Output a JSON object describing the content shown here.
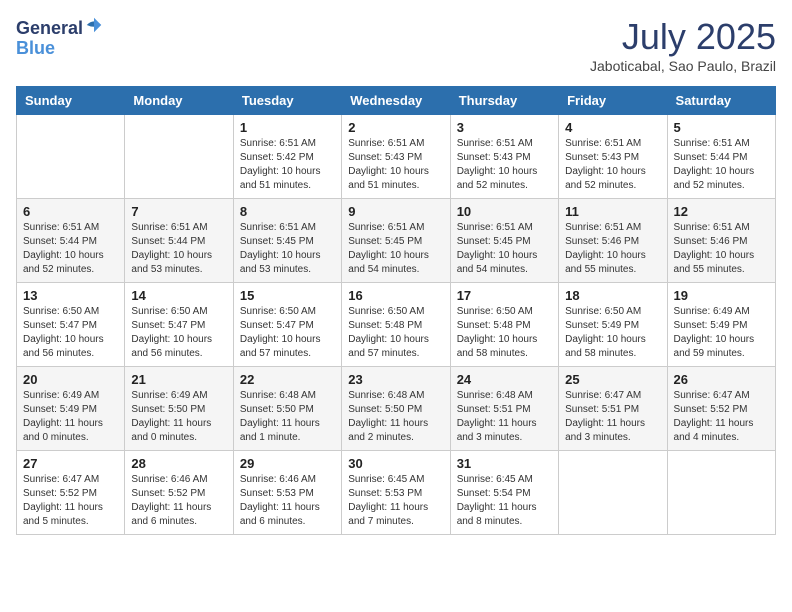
{
  "header": {
    "logo_line1": "General",
    "logo_line2": "Blue",
    "month": "July 2025",
    "location": "Jaboticabal, Sao Paulo, Brazil"
  },
  "days_of_week": [
    "Sunday",
    "Monday",
    "Tuesday",
    "Wednesday",
    "Thursday",
    "Friday",
    "Saturday"
  ],
  "weeks": [
    [
      {
        "day": "",
        "content": ""
      },
      {
        "day": "",
        "content": ""
      },
      {
        "day": "1",
        "content": "Sunrise: 6:51 AM\nSunset: 5:42 PM\nDaylight: 10 hours and 51 minutes."
      },
      {
        "day": "2",
        "content": "Sunrise: 6:51 AM\nSunset: 5:43 PM\nDaylight: 10 hours and 51 minutes."
      },
      {
        "day": "3",
        "content": "Sunrise: 6:51 AM\nSunset: 5:43 PM\nDaylight: 10 hours and 52 minutes."
      },
      {
        "day": "4",
        "content": "Sunrise: 6:51 AM\nSunset: 5:43 PM\nDaylight: 10 hours and 52 minutes."
      },
      {
        "day": "5",
        "content": "Sunrise: 6:51 AM\nSunset: 5:44 PM\nDaylight: 10 hours and 52 minutes."
      }
    ],
    [
      {
        "day": "6",
        "content": "Sunrise: 6:51 AM\nSunset: 5:44 PM\nDaylight: 10 hours and 52 minutes."
      },
      {
        "day": "7",
        "content": "Sunrise: 6:51 AM\nSunset: 5:44 PM\nDaylight: 10 hours and 53 minutes."
      },
      {
        "day": "8",
        "content": "Sunrise: 6:51 AM\nSunset: 5:45 PM\nDaylight: 10 hours and 53 minutes."
      },
      {
        "day": "9",
        "content": "Sunrise: 6:51 AM\nSunset: 5:45 PM\nDaylight: 10 hours and 54 minutes."
      },
      {
        "day": "10",
        "content": "Sunrise: 6:51 AM\nSunset: 5:45 PM\nDaylight: 10 hours and 54 minutes."
      },
      {
        "day": "11",
        "content": "Sunrise: 6:51 AM\nSunset: 5:46 PM\nDaylight: 10 hours and 55 minutes."
      },
      {
        "day": "12",
        "content": "Sunrise: 6:51 AM\nSunset: 5:46 PM\nDaylight: 10 hours and 55 minutes."
      }
    ],
    [
      {
        "day": "13",
        "content": "Sunrise: 6:50 AM\nSunset: 5:47 PM\nDaylight: 10 hours and 56 minutes."
      },
      {
        "day": "14",
        "content": "Sunrise: 6:50 AM\nSunset: 5:47 PM\nDaylight: 10 hours and 56 minutes."
      },
      {
        "day": "15",
        "content": "Sunrise: 6:50 AM\nSunset: 5:47 PM\nDaylight: 10 hours and 57 minutes."
      },
      {
        "day": "16",
        "content": "Sunrise: 6:50 AM\nSunset: 5:48 PM\nDaylight: 10 hours and 57 minutes."
      },
      {
        "day": "17",
        "content": "Sunrise: 6:50 AM\nSunset: 5:48 PM\nDaylight: 10 hours and 58 minutes."
      },
      {
        "day": "18",
        "content": "Sunrise: 6:50 AM\nSunset: 5:49 PM\nDaylight: 10 hours and 58 minutes."
      },
      {
        "day": "19",
        "content": "Sunrise: 6:49 AM\nSunset: 5:49 PM\nDaylight: 10 hours and 59 minutes."
      }
    ],
    [
      {
        "day": "20",
        "content": "Sunrise: 6:49 AM\nSunset: 5:49 PM\nDaylight: 11 hours and 0 minutes."
      },
      {
        "day": "21",
        "content": "Sunrise: 6:49 AM\nSunset: 5:50 PM\nDaylight: 11 hours and 0 minutes."
      },
      {
        "day": "22",
        "content": "Sunrise: 6:48 AM\nSunset: 5:50 PM\nDaylight: 11 hours and 1 minute."
      },
      {
        "day": "23",
        "content": "Sunrise: 6:48 AM\nSunset: 5:50 PM\nDaylight: 11 hours and 2 minutes."
      },
      {
        "day": "24",
        "content": "Sunrise: 6:48 AM\nSunset: 5:51 PM\nDaylight: 11 hours and 3 minutes."
      },
      {
        "day": "25",
        "content": "Sunrise: 6:47 AM\nSunset: 5:51 PM\nDaylight: 11 hours and 3 minutes."
      },
      {
        "day": "26",
        "content": "Sunrise: 6:47 AM\nSunset: 5:52 PM\nDaylight: 11 hours and 4 minutes."
      }
    ],
    [
      {
        "day": "27",
        "content": "Sunrise: 6:47 AM\nSunset: 5:52 PM\nDaylight: 11 hours and 5 minutes."
      },
      {
        "day": "28",
        "content": "Sunrise: 6:46 AM\nSunset: 5:52 PM\nDaylight: 11 hours and 6 minutes."
      },
      {
        "day": "29",
        "content": "Sunrise: 6:46 AM\nSunset: 5:53 PM\nDaylight: 11 hours and 6 minutes."
      },
      {
        "day": "30",
        "content": "Sunrise: 6:45 AM\nSunset: 5:53 PM\nDaylight: 11 hours and 7 minutes."
      },
      {
        "day": "31",
        "content": "Sunrise: 6:45 AM\nSunset: 5:54 PM\nDaylight: 11 hours and 8 minutes."
      },
      {
        "day": "",
        "content": ""
      },
      {
        "day": "",
        "content": ""
      }
    ]
  ]
}
